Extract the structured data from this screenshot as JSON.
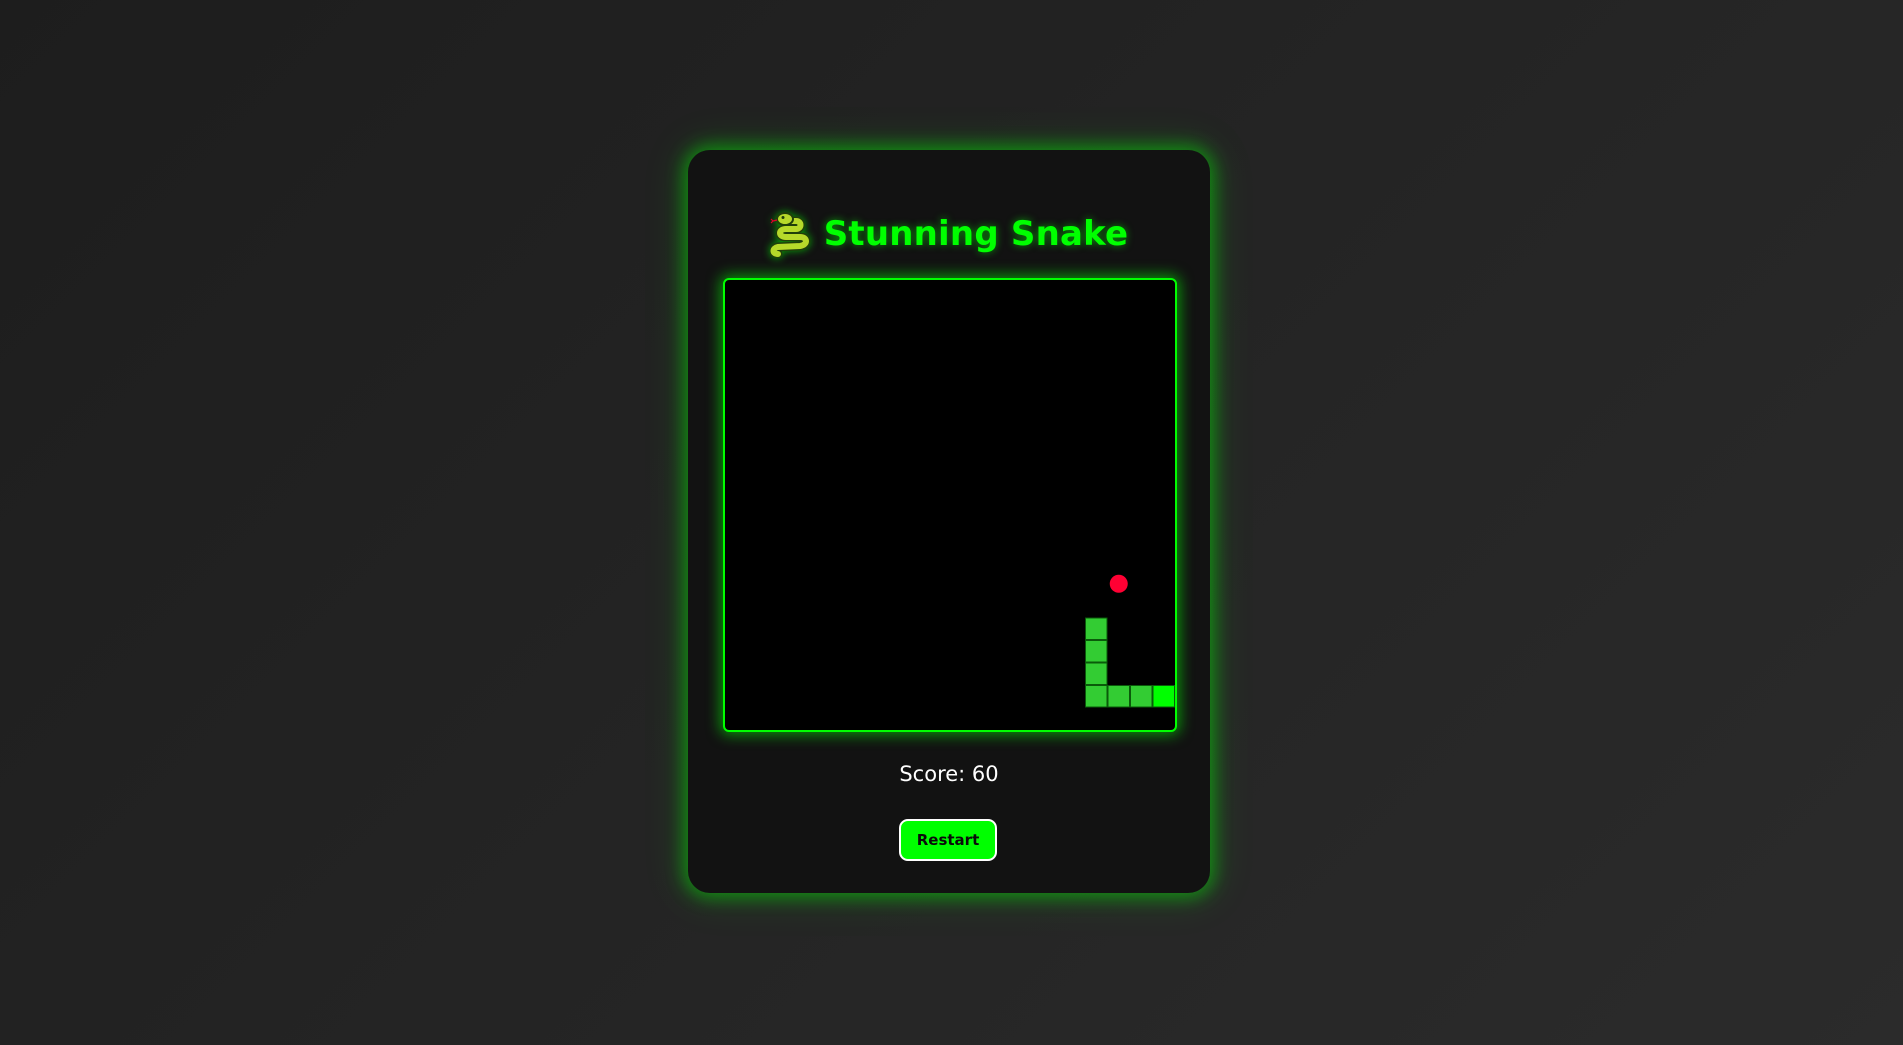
{
  "app": {
    "title": "Stunning Snake",
    "title_icon": "snake-icon"
  },
  "game": {
    "grid_cols": 20,
    "grid_rows": 20,
    "snake_segments": [
      {
        "col": 19,
        "row": 18,
        "head": true
      },
      {
        "col": 18,
        "row": 18
      },
      {
        "col": 17,
        "row": 18
      },
      {
        "col": 16,
        "row": 18
      },
      {
        "col": 16,
        "row": 17
      },
      {
        "col": 16,
        "row": 16
      },
      {
        "col": 16,
        "row": 15
      }
    ],
    "food": {
      "col": 17,
      "row": 13
    },
    "score_text": "Score: 60"
  },
  "controls": {
    "restart_label": "Restart"
  },
  "colors": {
    "accent": "#00ff00",
    "snake_body": "#33cc33",
    "snake_head": "#00ff00",
    "food": "#ff0033",
    "board_bg": "#000000",
    "card_bg": "#121212"
  }
}
